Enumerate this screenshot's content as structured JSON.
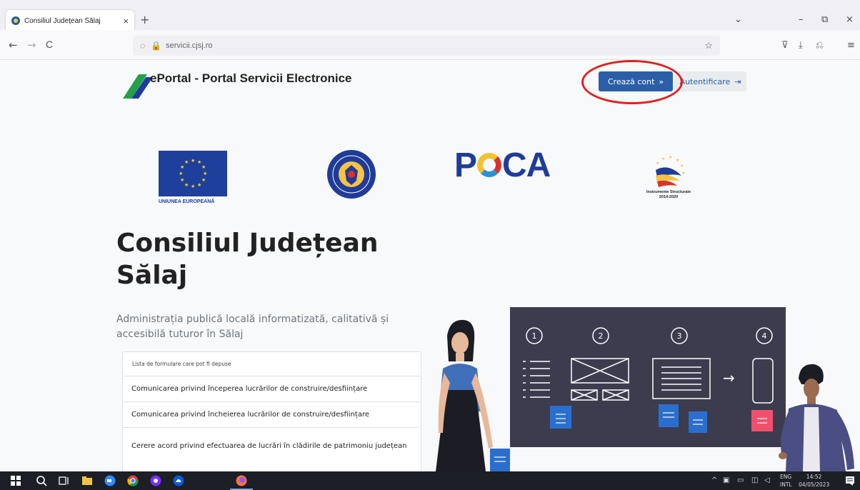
{
  "browser": {
    "tab_title": "Consiliul Județean Sălaj",
    "tab_close": "×",
    "new_tab": "+",
    "url": "servicii.cjsj.ro",
    "back": "←",
    "forward": "→",
    "reload": "C",
    "list_tabs": "⌄",
    "minimize": "–",
    "restore": "⧉",
    "close": "×",
    "bookmark": "☆",
    "pocket": "⊽",
    "download": "⤓",
    "extensions": "⎌",
    "menu": "≡",
    "shield": "◌",
    "lock": "🔒"
  },
  "header": {
    "brand": "ePortal - Portal Servicii Electronice",
    "create_label": "Crează cont",
    "create_icon": "»",
    "login_label": "Autentificare",
    "login_icon": "⇥"
  },
  "logos": {
    "eu_caption": "UNIUNEA EUROPEANĂ",
    "poca_p": "P",
    "poca_ca": "CA",
    "is_caption_line1": "Instrumente Structurale",
    "is_caption_line2": "2014-2020"
  },
  "hero": {
    "title": "Consiliul Județean Sălaj",
    "subtitle": "Administrația publică locală informatizată, calitativă și accesibilă tuturor în Sălaj"
  },
  "forms": {
    "heading": "Lista de formulare care pot fi depuse",
    "items": [
      "Comunicarea privind începerea lucrărilor de construire/desființare",
      "Comunicarea privind încheierea lucrărilor de construire/desființare",
      "Cerere acord privind efectuarea de lucrări în clădirile de patrimoniu județean"
    ]
  },
  "illustration": {
    "steps": [
      "1",
      "2",
      "3",
      "4"
    ],
    "arrow": "→"
  },
  "taskbar": {
    "lang_line1": "ENG",
    "lang_line2": "INTL",
    "time": "14:52",
    "date": "04/05/2023"
  },
  "colors": {
    "primary": "#2a5fa8",
    "board": "#3d3c4f",
    "annotation": "#e02020"
  }
}
